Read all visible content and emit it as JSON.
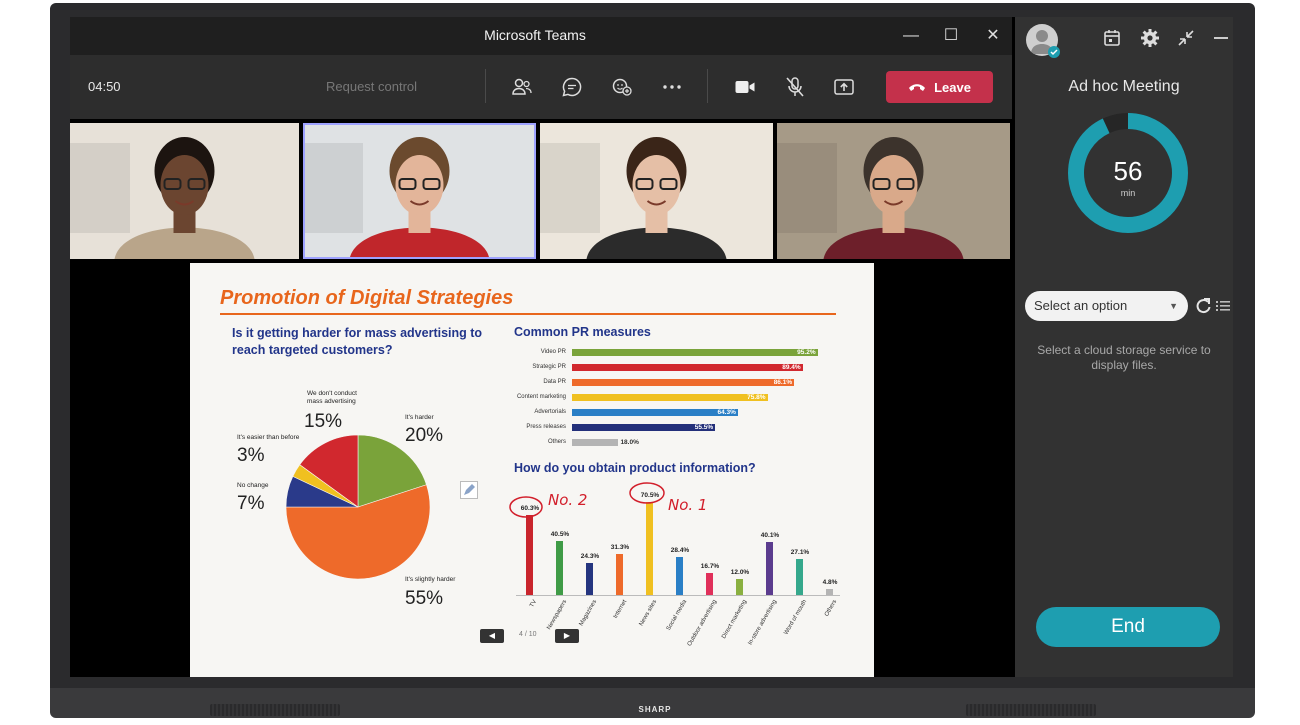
{
  "device": {
    "brand": "SHARP"
  },
  "teams": {
    "window_title": "Microsoft Teams",
    "timer": "04:50",
    "request_control_label": "Request control",
    "leave_label": "Leave",
    "toolbar_icons": [
      "people-icon",
      "chat-icon",
      "reactions-icon",
      "more-icon",
      "camera-icon",
      "mic-off-icon",
      "share-icon"
    ]
  },
  "participants": [
    {
      "name": "participant-1",
      "skin": "#6b4530",
      "shirt": "#b9a58a",
      "bg": "#e7e1d8",
      "hair": "#1c1410"
    },
    {
      "name": "participant-2",
      "skin": "#e3b59a",
      "shirt": "#c0262b",
      "bg": "#dfe2e4",
      "hair": "#6b4a2e"
    },
    {
      "name": "participant-3",
      "skin": "#e5bfa6",
      "shirt": "#2b2b2b",
      "bg": "#ece6dc",
      "hair": "#3a2518"
    },
    {
      "name": "participant-4",
      "skin": "#d9a98a",
      "shirt": "#6d1f2a",
      "bg": "#a69a87",
      "hair": "#3c332c"
    }
  ],
  "slide": {
    "title": "Promotion of Digital Strategies",
    "question1": "Is it getting harder for mass advertising to reach targeted customers?",
    "question2": "Common PR measures",
    "question3": "How do you obtain product information?",
    "pager": "4 / 10",
    "annotation_no2": "No. 2",
    "annotation_no1": "No. 1",
    "pie_labels": {
      "no_mass": "We don't conduct mass advertising",
      "harder": "It's harder",
      "easier": "It's easier than before",
      "no_change": "No change",
      "slightly_harder": "It's slightly harder"
    }
  },
  "chart_data": [
    {
      "type": "pie",
      "title": "Is it getting harder for mass advertising to reach targeted customers?",
      "slices": [
        {
          "label": "It's harder",
          "value": 20,
          "display": "20%",
          "color": "#7aa33a"
        },
        {
          "label": "It's slightly harder",
          "value": 55,
          "display": "55%",
          "color": "#ee6a2a"
        },
        {
          "label": "No change",
          "value": 7,
          "display": "7%",
          "color": "#2a3a8a"
        },
        {
          "label": "It's easier than before",
          "value": 3,
          "display": "3%",
          "color": "#f0c020"
        },
        {
          "label": "We don't conduct mass advertising",
          "value": 15,
          "display": "15%",
          "color": "#d1282e"
        }
      ]
    },
    {
      "type": "bar",
      "orientation": "horizontal",
      "title": "Common PR measures",
      "categories": [
        "Video PR",
        "Strategic PR",
        "Data PR",
        "Content marketing",
        "Advertorials",
        "Press releases",
        "Others"
      ],
      "values": [
        95.2,
        89.4,
        86.1,
        75.8,
        64.3,
        55.5,
        18.0
      ],
      "labels": [
        "95.2%",
        "89.4%",
        "86.1%",
        "75.8%",
        "64.3%",
        "55.5%",
        "18.0%"
      ],
      "colors": [
        "#7aa33a",
        "#d1282e",
        "#ee6a2a",
        "#f0c020",
        "#2a7fc6",
        "#24307a",
        "#b4b4b4"
      ],
      "xlim": [
        0,
        100
      ]
    },
    {
      "type": "bar",
      "orientation": "vertical",
      "title": "How do you obtain product information?",
      "categories": [
        "TV",
        "Newspapers",
        "Magazines",
        "Internet",
        "News sites",
        "Social media",
        "Outdoor advertising",
        "Direct marketing",
        "In-store advertising",
        "Word of mouth",
        "Others"
      ],
      "values": [
        60.3,
        40.5,
        24.3,
        31.3,
        70.5,
        28.4,
        16.7,
        12.0,
        40.1,
        27.1,
        4.8
      ],
      "labels": [
        "60.3%",
        "40.5%",
        "24.3%",
        "31.3%",
        "70.5%",
        "28.4%",
        "16.7%",
        "12.0%",
        "40.1%",
        "27.1%",
        "4.8%"
      ],
      "colors": [
        "#c9252c",
        "#3f9b46",
        "#25357f",
        "#ee6a2a",
        "#f0c020",
        "#2a7fc6",
        "#e0305a",
        "#8ab040",
        "#5b3c8e",
        "#35a88c",
        "#b4b4b4"
      ],
      "ylim": [
        0,
        80
      ]
    }
  ],
  "panel": {
    "meeting_name": "Ad hoc Meeting",
    "minutes": "56",
    "minutes_unit": "min",
    "progress_fraction": 0.93,
    "select_placeholder": "Select an option",
    "hint": "Select a cloud storage service to display files.",
    "end_label": "End",
    "accent": "#1e9eb0"
  }
}
